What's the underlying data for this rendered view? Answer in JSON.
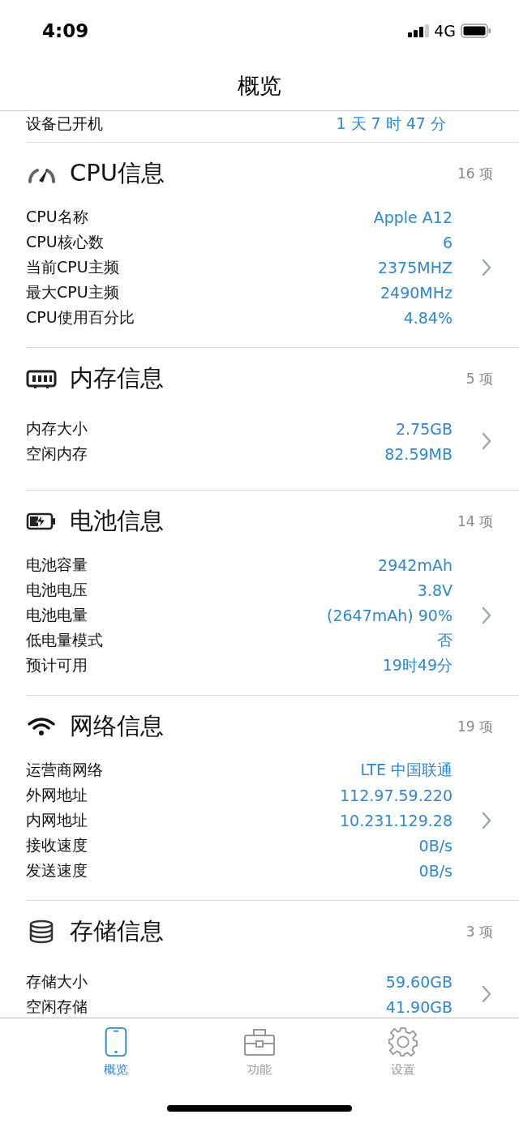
{
  "status_bar": {
    "time": "4:09",
    "network": "4G"
  },
  "nav": {
    "title": "概览"
  },
  "partial_row": {
    "label": "设备已开机",
    "value": "1 天 7 时 47 分"
  },
  "sections": [
    {
      "kind": "cpu",
      "title": "CPU信息",
      "count": "16 项",
      "rows": [
        {
          "label": "CPU名称",
          "value": "Apple A12"
        },
        {
          "label": "CPU核心数",
          "value": "6"
        },
        {
          "label": "当前CPU主频",
          "value": "2375MHZ"
        },
        {
          "label": "最大CPU主频",
          "value": "2490MHz"
        },
        {
          "label": "CPU使用百分比",
          "value": "4.84%"
        }
      ]
    },
    {
      "kind": "memory",
      "title": "内存信息",
      "count": "5 项",
      "rows": [
        {
          "label": "内存大小",
          "value": "2.75GB"
        },
        {
          "label": "空闲内存",
          "value": "82.59MB"
        }
      ]
    },
    {
      "kind": "battery",
      "title": "电池信息",
      "count": "14 项",
      "rows": [
        {
          "label": "电池容量",
          "value": "2942mAh"
        },
        {
          "label": "电池电压",
          "value": "3.8V"
        },
        {
          "label": "电池电量",
          "value": "(2647mAh) 90%"
        },
        {
          "label": "低电量模式",
          "value": "否"
        },
        {
          "label": "预计可用",
          "value": "19时49分"
        }
      ]
    },
    {
      "kind": "network",
      "title": "网络信息",
      "count": "19 项",
      "rows": [
        {
          "label": "运营商网络",
          "value": "LTE 中国联通"
        },
        {
          "label": "外网地址",
          "value": "112.97.59.220"
        },
        {
          "label": "内网地址",
          "value": "10.231.129.28"
        },
        {
          "label": "接收速度",
          "value": "0B/s"
        },
        {
          "label": "发送速度",
          "value": "0B/s"
        }
      ]
    },
    {
      "kind": "storage",
      "title": "存储信息",
      "count": "3 项",
      "rows": [
        {
          "label": "存储大小",
          "value": "59.60GB"
        },
        {
          "label": "空闲存储",
          "value": "41.90GB"
        }
      ]
    }
  ],
  "tab_bar": [
    {
      "kind": "device",
      "label": "概览",
      "selected": true
    },
    {
      "kind": "tools",
      "label": "功能",
      "selected": false
    },
    {
      "kind": "settings",
      "label": "设置",
      "selected": false
    }
  ]
}
